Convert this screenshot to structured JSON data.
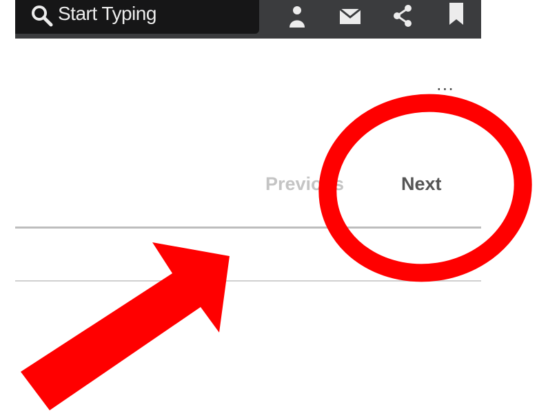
{
  "toolbar": {
    "search_placeholder": "Start Typing",
    "icons": [
      "search-icon",
      "user-icon",
      "mail-icon",
      "share-icon",
      "bookmark-icon"
    ]
  },
  "menu": {
    "more_label": "..."
  },
  "pagination": {
    "previous_label": "Previous",
    "next_label": "Next"
  },
  "annotations": {
    "highlight": "circle around Next",
    "pointer": "arrow pointing toward pagination",
    "color": "#ff0000"
  },
  "colors": {
    "toolbar_bg": "#3b3c3e",
    "search_bg": "#161617",
    "annotation_red": "#ff0000",
    "next_text": "#555555",
    "previous_text": "#c4c4c4"
  }
}
